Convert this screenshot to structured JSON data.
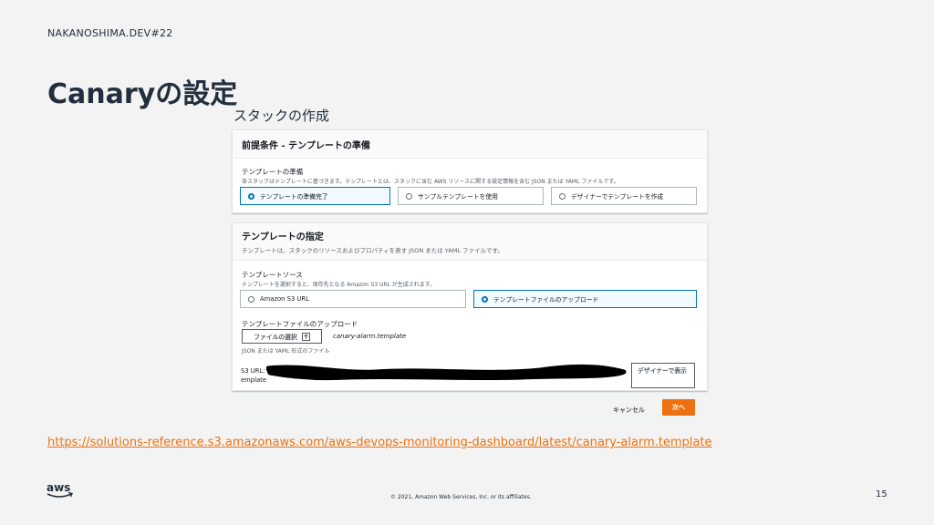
{
  "slide": {
    "event": "NAKANOSHIMA.DEV#22",
    "title": "Canaryの設定",
    "subtitle": "スタックの作成",
    "link": "https://solutions-reference.s3.amazonaws.com/aws-devops-monitoring-dashboard/latest/canary-alarm.template",
    "copyright": "© 2021, Amazon Web Services, Inc. or its affiliates.",
    "page_number": "15"
  },
  "prereq": {
    "heading": "前提条件 - テンプレートの準備",
    "label": "テンプレートの準備",
    "description": "各スタックはテンプレートに基づきます。テンプレートとは、スタックに含む AWS リソースに関する設定情報を含む JSON または YAML ファイルです。",
    "options": [
      "テンプレートの準備完了",
      "サンプルテンプレートを使用",
      "デザイナーでテンプレートを作成"
    ],
    "selected_index": 0
  },
  "specify": {
    "heading": "テンプレートの指定",
    "heading_description": "テンプレートは、スタックのリソースおよびプロパティを表す JSON または YAML ファイルです。",
    "source_label": "テンプレートソース",
    "source_description": "テンプレートを選択すると、保存先となる Amazon S3 URL が生成されます。",
    "source_options": [
      "Amazon S3 URL",
      "テンプレートファイルのアップロード"
    ],
    "selected_index": 1,
    "upload_label": "テンプレートファイルのアップロード",
    "choose_file_label": "ファイルの選択",
    "file_name": "canary-alarm.template",
    "file_hint": "JSON または YAML 形式のファイル",
    "s3_url_label": "S3 URL:",
    "s3_url_tail": "emplate",
    "designer_button": "デザイナーで表示"
  },
  "footer": {
    "cancel_label": "キャンセル",
    "next_label": "次へ"
  },
  "colors": {
    "accent": "#ec7211",
    "selected": "#0073bb",
    "text": "#232f3e"
  }
}
